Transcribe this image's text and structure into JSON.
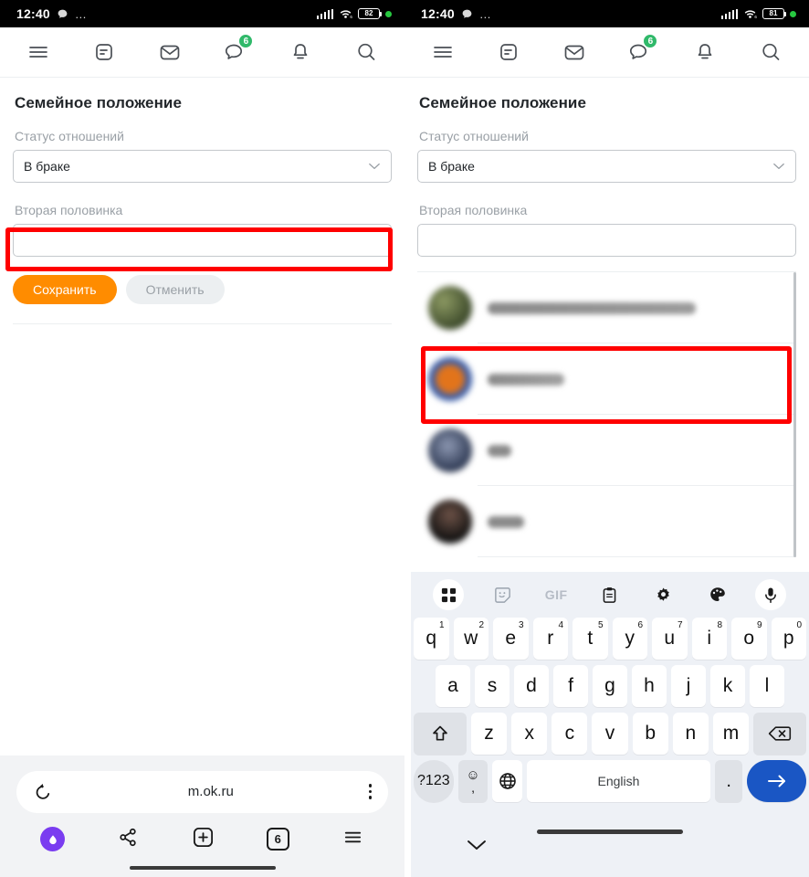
{
  "colors": {
    "accent_orange": "#ff8c00",
    "badge_green": "#30b96a",
    "highlight_red": "#ff0000",
    "enter_blue": "#1a56c4",
    "alice_purple": "#7a3cf0"
  },
  "left": {
    "statusbar": {
      "time": "12:40",
      "overflow": "…",
      "battery": "82",
      "wifi_gen": "6"
    },
    "topnav": [
      {
        "name": "menu-icon",
        "badge": null
      },
      {
        "name": "feed-icon",
        "badge": null
      },
      {
        "name": "mail-icon",
        "badge": null
      },
      {
        "name": "messages-icon",
        "badge": "6"
      },
      {
        "name": "notifications-icon",
        "badge": null
      },
      {
        "name": "search-icon",
        "badge": null
      }
    ],
    "page_title": "Семейное положение",
    "status_label": "Статус отношений",
    "status_value": "В браке",
    "partner_label": "Вторая половинка",
    "partner_value": "",
    "partner_placeholder": "",
    "save_label": "Сохранить",
    "cancel_label": "Отменить",
    "browser": {
      "url": "m.ok.ru",
      "reload_icon": "reload-icon",
      "menu_icon": "kebab-menu-icon",
      "nav": [
        {
          "name": "alice-assistant-button",
          "label": ""
        },
        {
          "name": "share-button",
          "label": ""
        },
        {
          "name": "new-tab-button",
          "label": ""
        },
        {
          "name": "tabs-button",
          "label": "6"
        },
        {
          "name": "browser-menu-button",
          "label": ""
        }
      ]
    }
  },
  "right": {
    "statusbar": {
      "time": "12:40",
      "overflow": "…",
      "battery": "81",
      "wifi_gen": "6"
    },
    "topnav": [
      {
        "name": "menu-icon",
        "badge": null
      },
      {
        "name": "feed-icon",
        "badge": null
      },
      {
        "name": "mail-icon",
        "badge": null
      },
      {
        "name": "messages-icon",
        "badge": "6"
      },
      {
        "name": "notifications-icon",
        "badge": null
      },
      {
        "name": "search-icon",
        "badge": null
      }
    ],
    "page_title": "Семейное положение",
    "status_label": "Статус отношений",
    "status_value": "В браке",
    "partner_label": "Вторая половинка",
    "partner_value": "",
    "partner_placeholder": "",
    "suggestions": [
      {
        "name": "",
        "redacted": true,
        "name_width": 228,
        "avatar_colors": [
          "#6b7a4a",
          "#3c4a2e"
        ]
      },
      {
        "name": "",
        "redacted": true,
        "name_width": 84,
        "avatar_colors": [
          "#d2691e",
          "#3b5ea8"
        ]
      },
      {
        "name": "",
        "redacted": true,
        "name_width": 26,
        "avatar_colors": [
          "#5b6b8a",
          "#2a3550"
        ]
      },
      {
        "name": "",
        "redacted": true,
        "name_width": 40,
        "avatar_colors": [
          "#4a3a36",
          "#151515"
        ]
      }
    ],
    "keyboard": {
      "toolbar": [
        {
          "name": "keyboard-grid-icon",
          "label": ""
        },
        {
          "name": "sticker-icon",
          "label": ""
        },
        {
          "name": "gif-icon",
          "label": "GIF"
        },
        {
          "name": "clipboard-icon",
          "label": ""
        },
        {
          "name": "settings-gear-icon",
          "label": ""
        },
        {
          "name": "theme-palette-icon",
          "label": ""
        },
        {
          "name": "microphone-icon",
          "label": ""
        }
      ],
      "row1": [
        {
          "key": "q",
          "num": "1"
        },
        {
          "key": "w",
          "num": "2"
        },
        {
          "key": "e",
          "num": "3"
        },
        {
          "key": "r",
          "num": "4"
        },
        {
          "key": "t",
          "num": "5"
        },
        {
          "key": "y",
          "num": "6"
        },
        {
          "key": "u",
          "num": "7"
        },
        {
          "key": "i",
          "num": "8"
        },
        {
          "key": "o",
          "num": "9"
        },
        {
          "key": "p",
          "num": "0"
        }
      ],
      "row2": [
        "a",
        "s",
        "d",
        "f",
        "g",
        "h",
        "j",
        "k",
        "l"
      ],
      "row3": [
        "z",
        "x",
        "c",
        "v",
        "b",
        "n",
        "m"
      ],
      "shift_icon": "shift-icon",
      "backspace_icon": "backspace-icon",
      "symbols_label": "?123",
      "emoji_top": "☺",
      "emoji_bottom": ",",
      "globe_icon": "language-globe-icon",
      "space_label": "English",
      "period_label": ".",
      "enter_icon": "enter-arrow-icon",
      "collapse_icon": "collapse-keyboard-icon"
    }
  }
}
